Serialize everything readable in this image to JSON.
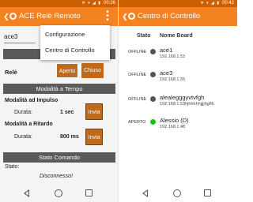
{
  "left": {
    "status_bar": {
      "time": "00:26",
      "icons": "✲ ▾ ◢ ▮"
    },
    "app_bar": {
      "title": "ACE Relè Remoto",
      "overflow_icon": "⋮"
    },
    "device_input": {
      "value": "ace3"
    },
    "section_control": {
      "label": "Co"
    },
    "rele": {
      "label": "Relè",
      "aperto_button": "Aperto",
      "chiuso_button": "Chiuso"
    },
    "section_mode": {
      "label": "Modalità a Tempo"
    },
    "impulse": {
      "title": "Modalità ad Impulso",
      "duration_label": "Durata:",
      "duration_value": "1 sec",
      "send_button": "Invia"
    },
    "delay": {
      "title": "Modalità a Ritardo",
      "duration_label": "Durata:",
      "duration_value": "800 ms",
      "send_button": "Invia"
    },
    "section_status": {
      "label": "Stato Comando"
    },
    "status": {
      "label": "Stato:",
      "value": "Disconnesso!"
    },
    "menu": {
      "items": [
        {
          "label": "Configurazione"
        },
        {
          "label": "Centro di Controllo"
        }
      ]
    }
  },
  "right": {
    "status_bar": {
      "time": "00:42",
      "icons": "✲ ▾ ◢ ▮"
    },
    "app_bar": {
      "title": "Centro di Controllo"
    },
    "columns": {
      "status": "Stato",
      "name": "Nome Board"
    },
    "boards": [
      {
        "status": "OFFLINE",
        "name": "ace1",
        "ip": "192.168.1.53",
        "dot_color": "#555555"
      },
      {
        "status": "OFFLINE",
        "name": "ace3",
        "ip": "192.168.1.55",
        "dot_color": "#555555"
      },
      {
        "status": "OFFLINE",
        "name": "alealegggyvtvfgh",
        "ip": "192.168.1.53hjhhhhhjjjjhgfth",
        "dot_color": "#555555"
      },
      {
        "status": "APERTO",
        "name": "Alessio (D)",
        "ip": "192.168.1.48",
        "dot_color": "#19c219"
      }
    ]
  },
  "colors": {
    "status_bar": "#cc5f00",
    "app_bar": "#f58220",
    "button": "#bd6a1f",
    "section_header": "#5a5a5a",
    "online_dot": "#19c219",
    "offline_dot": "#555555"
  },
  "icons": {
    "back": "back-arrow-icon",
    "logo": "app-logo-icon",
    "overflow": "overflow-menu-icon",
    "nav_back": "nav-back-icon",
    "nav_home": "nav-home-icon",
    "nav_recent": "nav-recent-icon"
  }
}
